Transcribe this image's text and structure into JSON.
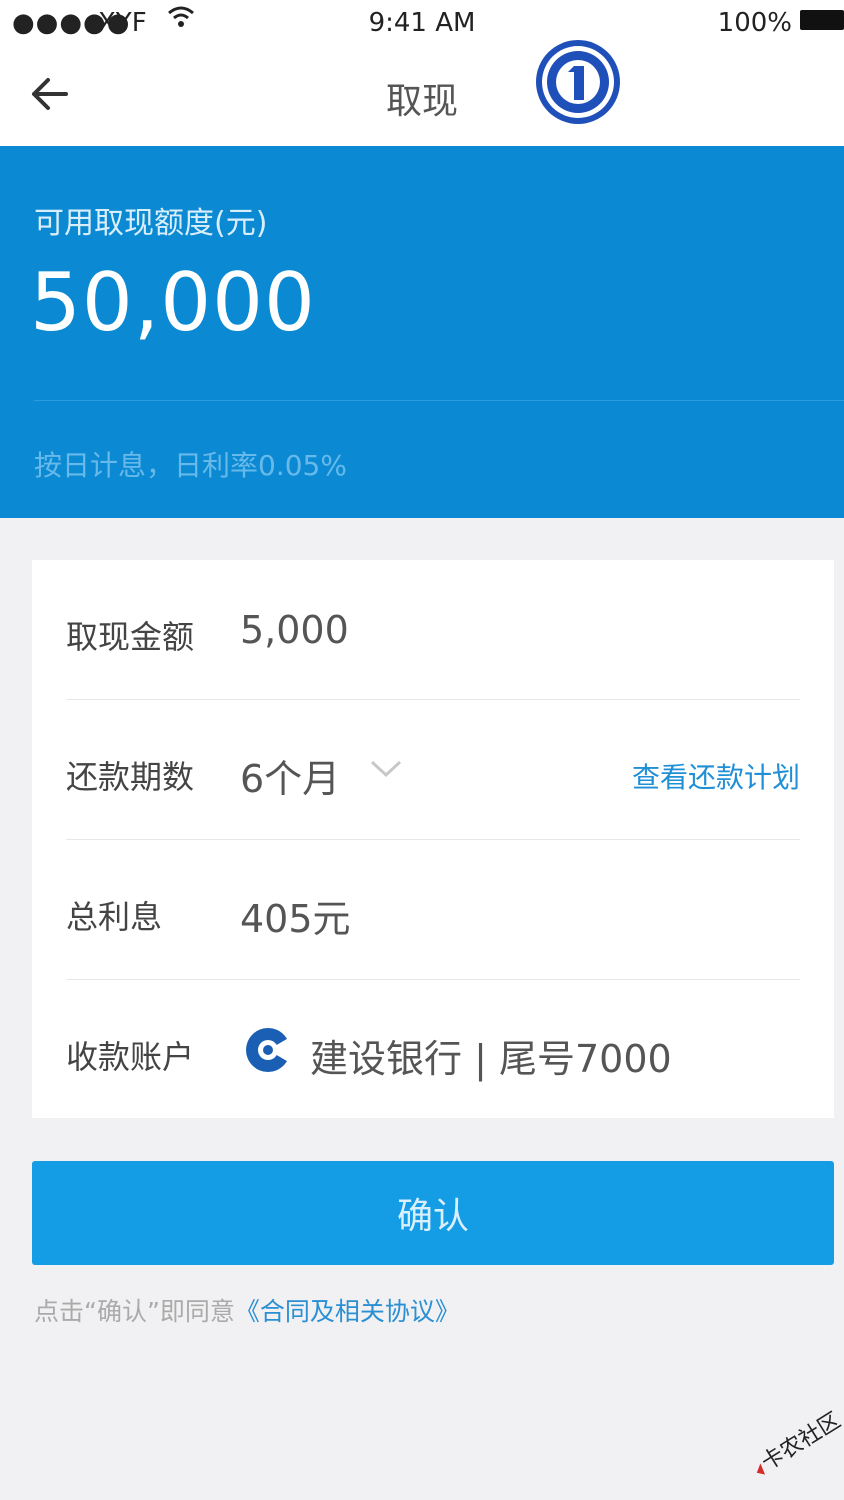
{
  "status_bar": {
    "signal": "●●●●●",
    "carrier": "XYF",
    "time": "9:41 AM",
    "battery": "100%"
  },
  "nav": {
    "title": "取现"
  },
  "hero": {
    "label": "可用取现额度(元)",
    "amount": "50,000",
    "rate_note": "按日计息，日利率0.05%"
  },
  "form": {
    "rows": [
      {
        "label": "取现金额",
        "value": "5,000"
      },
      {
        "label": "还款期数",
        "value": "6个月",
        "link": "查看还款计划"
      },
      {
        "label": "总利息",
        "value": "405元"
      },
      {
        "label": "收款账户",
        "value": "建设银行 | 尾号7000"
      }
    ]
  },
  "confirm_button": {
    "label": "确认"
  },
  "agreement": {
    "prefix": "点击“确认”即同意",
    "link": "《合同及相关协议》"
  },
  "watermark": {
    "text": "卡农社区"
  },
  "colors": {
    "primary_blue": "#0b8ad3",
    "button_blue": "#149ce4",
    "link_blue": "#1f8fd6",
    "background": "#f1f1f3"
  }
}
